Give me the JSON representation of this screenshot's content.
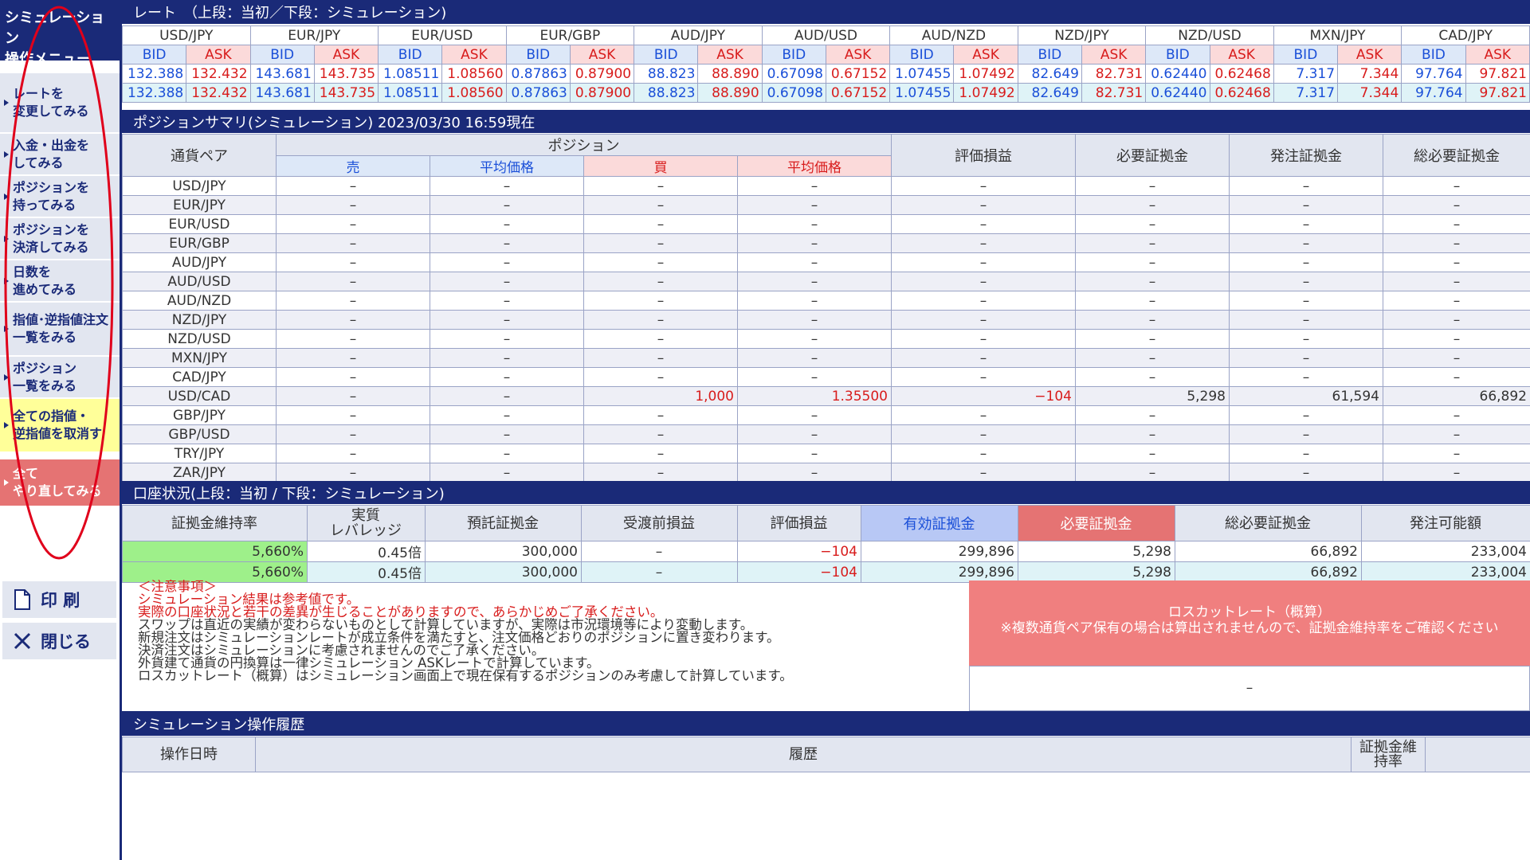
{
  "sidebar": {
    "title_line1": "シミュレーション",
    "title_line2": "操作メニュー",
    "items": [
      {
        "line1": "レートを",
        "line2": "変更してみる",
        "style": "normal"
      },
      {
        "line1": "入金・出金を",
        "line2": "してみる",
        "style": "normal"
      },
      {
        "line1": "ポジションを",
        "line2": "持ってみる",
        "style": "normal"
      },
      {
        "line1": "ポジションを",
        "line2": "決済してみる",
        "style": "normal"
      },
      {
        "line1": "日数を",
        "line2": "進めてみる",
        "style": "normal"
      },
      {
        "line1": "指値･逆指値注文",
        "line2": "一覧をみる",
        "style": "normal"
      },
      {
        "line1": "ポジション",
        "line2": "一覧をみる",
        "style": "normal"
      },
      {
        "line1": "全ての指値・",
        "line2": "逆指値を取消す",
        "style": "yellow"
      },
      {
        "line1": "全て",
        "line2": "やり直してみる",
        "style": "red"
      }
    ],
    "print_label": "印 刷",
    "print_icon": "document-icon",
    "close_label": "閉じる",
    "close_icon": "close-icon"
  },
  "rates": {
    "header": "レート　（上段：当初／下段：シミュレーション)",
    "bid_label": "BID",
    "ask_label": "ASK",
    "pairs": [
      {
        "name": "USD/JPY",
        "initial": [
          "132.388",
          "132.432"
        ],
        "sim": [
          "132.388",
          "132.432"
        ]
      },
      {
        "name": "EUR/JPY",
        "initial": [
          "143.681",
          "143.735"
        ],
        "sim": [
          "143.681",
          "143.735"
        ]
      },
      {
        "name": "EUR/USD",
        "initial": [
          "1.08511",
          "1.08560"
        ],
        "sim": [
          "1.08511",
          "1.08560"
        ]
      },
      {
        "name": "EUR/GBP",
        "initial": [
          "0.87863",
          "0.87900"
        ],
        "sim": [
          "0.87863",
          "0.87900"
        ]
      },
      {
        "name": "AUD/JPY",
        "initial": [
          "88.823",
          "88.890"
        ],
        "sim": [
          "88.823",
          "88.890"
        ]
      },
      {
        "name": "AUD/USD",
        "initial": [
          "0.67098",
          "0.67152"
        ],
        "sim": [
          "0.67098",
          "0.67152"
        ]
      },
      {
        "name": "AUD/NZD",
        "initial": [
          "1.07455",
          "1.07492"
        ],
        "sim": [
          "1.07455",
          "1.07492"
        ]
      },
      {
        "name": "NZD/JPY",
        "initial": [
          "82.649",
          "82.731"
        ],
        "sim": [
          "82.649",
          "82.731"
        ]
      },
      {
        "name": "NZD/USD",
        "initial": [
          "0.62440",
          "0.62468"
        ],
        "sim": [
          "0.62440",
          "0.62468"
        ]
      },
      {
        "name": "MXN/JPY",
        "initial": [
          "7.317",
          "7.344"
        ],
        "sim": [
          "7.317",
          "7.344"
        ]
      },
      {
        "name": "CAD/JPY",
        "initial": [
          "97.764",
          "97.821"
        ],
        "sim": [
          "97.764",
          "97.821"
        ]
      }
    ]
  },
  "positions": {
    "header": "ポジションサマリ(シミュレーション)  2023/03/30 16:59現在",
    "col_pair": "通貨ペア",
    "col_position": "ポジション",
    "col_sell": "売",
    "col_avg_sell": "平均価格",
    "col_buy": "買",
    "col_avg_buy": "平均価格",
    "col_pl": "評価損益",
    "col_margin": "必要証拠金",
    "col_order_margin": "発注証拠金",
    "col_total_margin": "総必要証拠金",
    "rows": [
      {
        "pair": "USD/JPY",
        "cells": [
          "–",
          "–",
          "–",
          "–",
          "–",
          "–",
          "–",
          "–"
        ]
      },
      {
        "pair": "EUR/JPY",
        "cells": [
          "–",
          "–",
          "–",
          "–",
          "–",
          "–",
          "–",
          "–"
        ]
      },
      {
        "pair": "EUR/USD",
        "cells": [
          "–",
          "–",
          "–",
          "–",
          "–",
          "–",
          "–",
          "–"
        ]
      },
      {
        "pair": "EUR/GBP",
        "cells": [
          "–",
          "–",
          "–",
          "–",
          "–",
          "–",
          "–",
          "–"
        ]
      },
      {
        "pair": "AUD/JPY",
        "cells": [
          "–",
          "–",
          "–",
          "–",
          "–",
          "–",
          "–",
          "–"
        ]
      },
      {
        "pair": "AUD/USD",
        "cells": [
          "–",
          "–",
          "–",
          "–",
          "–",
          "–",
          "–",
          "–"
        ]
      },
      {
        "pair": "AUD/NZD",
        "cells": [
          "–",
          "–",
          "–",
          "–",
          "–",
          "–",
          "–",
          "–"
        ]
      },
      {
        "pair": "NZD/JPY",
        "cells": [
          "–",
          "–",
          "–",
          "–",
          "–",
          "–",
          "–",
          "–"
        ]
      },
      {
        "pair": "NZD/USD",
        "cells": [
          "–",
          "–",
          "–",
          "–",
          "–",
          "–",
          "–",
          "–"
        ]
      },
      {
        "pair": "MXN/JPY",
        "cells": [
          "–",
          "–",
          "–",
          "–",
          "–",
          "–",
          "–",
          "–"
        ]
      },
      {
        "pair": "CAD/JPY",
        "cells": [
          "–",
          "–",
          "–",
          "–",
          "–",
          "–",
          "–",
          "–"
        ]
      },
      {
        "pair": "USD/CAD",
        "cells": [
          "–",
          "–",
          "1,000",
          "1.35500",
          "−104",
          "5,298",
          "61,594",
          "66,892"
        ]
      },
      {
        "pair": "GBP/JPY",
        "cells": [
          "–",
          "–",
          "–",
          "–",
          "–",
          "–",
          "–",
          "–"
        ]
      },
      {
        "pair": "GBP/USD",
        "cells": [
          "–",
          "–",
          "–",
          "–",
          "–",
          "–",
          "–",
          "–"
        ]
      },
      {
        "pair": "TRY/JPY",
        "cells": [
          "–",
          "–",
          "–",
          "–",
          "–",
          "–",
          "–",
          "–"
        ]
      },
      {
        "pair": "ZAR/JPY",
        "cells": [
          "–",
          "–",
          "–",
          "–",
          "–",
          "–",
          "–",
          "–"
        ]
      }
    ]
  },
  "account": {
    "header": "口座状況(上段：当初 / 下段：シミュレーション)",
    "columns": [
      "証拠金維持率",
      "実質\nレバレッジ",
      "預託証拠金",
      "受渡前損益",
      "評価損益",
      "有効証拠金",
      "必要証拠金",
      "総必要証拠金",
      "発注可能額"
    ],
    "rows": [
      [
        "5,660%",
        "0.45倍",
        "300,000",
        "–",
        "−104",
        "299,896",
        "5,298",
        "66,892",
        "233,004"
      ],
      [
        "5,660%",
        "0.45倍",
        "300,000",
        "–",
        "−104",
        "299,896",
        "5,298",
        "66,892",
        "233,004"
      ]
    ]
  },
  "notes": {
    "title": "＜注意事項＞",
    "red_lines": [
      "シミュレーション結果は参考値です。",
      "実際の口座状況と若干の差異が生じることがありますので、あらかじめご了承ください。"
    ],
    "lines": [
      "スワップは直近の実績が変わらないものとして計算していますが、実際は市況環境等により変動します。",
      "新規注文はシミュレーションレートが成立条件を満たすと、注文価格どおりのポジションに置き変わります。",
      "決済注文はシミュレーションに考慮されませんのでご了承ください。",
      "外貨建て通貨の円換算は一律シミュレーション ASKレートで計算しています。",
      "ロスカットレート（概算）はシミュレーション画面上で現在保有するポジションのみ考慮して計算しています。"
    ]
  },
  "losscut": {
    "title": "ロスカットレート（概算）",
    "note": "※複数通貨ペア保有の場合は算出されませんので、証拠金維持率をご確認ください",
    "value": "–"
  },
  "history": {
    "header": "シミュレーション操作履歴",
    "col_datetime": "操作日時",
    "col_history": "履歴",
    "col_ratio": "証拠金維\n持率"
  },
  "colors": {
    "navy": "#1a2a78",
    "bid_blue": "#1a4fd8",
    "ask_red": "#d81c1c",
    "annotation_oval": "#e0001b"
  }
}
